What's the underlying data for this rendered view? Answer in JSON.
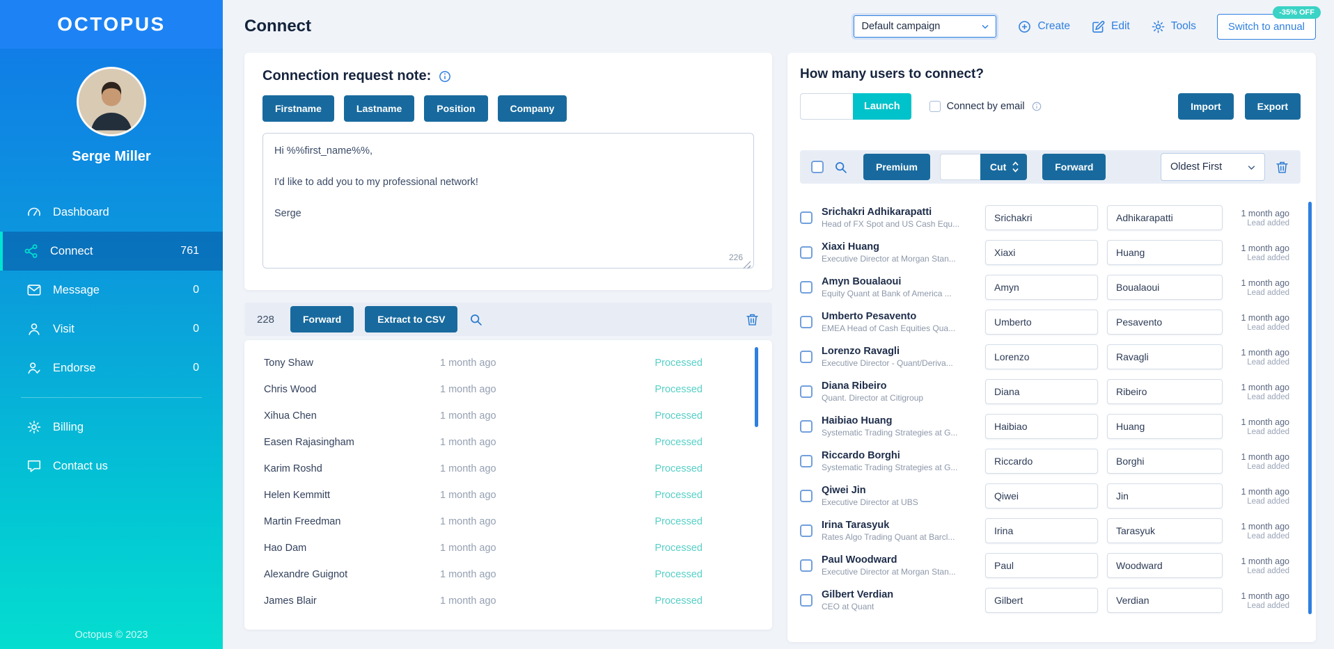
{
  "colors": {
    "accent_blue": "#2f80e0",
    "button_blue": "#186a9e",
    "teal": "#00c2ca",
    "status_teal": "#57cfc7",
    "sidebar_top": "#1177e8",
    "sidebar_bottom": "#05ddd0"
  },
  "sidebar": {
    "logo": "OCTOPUS",
    "user": {
      "name": "Serge Miller"
    },
    "nav": [
      {
        "label": "Dashboard",
        "count": ""
      },
      {
        "label": "Connect",
        "count": "761"
      },
      {
        "label": "Message",
        "count": "0"
      },
      {
        "label": "Visit",
        "count": "0"
      },
      {
        "label": "Endorse",
        "count": "0"
      }
    ],
    "secondary": [
      {
        "label": "Billing"
      },
      {
        "label": "Contact us"
      }
    ],
    "footer": "Octopus © 2023"
  },
  "header": {
    "title": "Connect",
    "campaign_select": "Default campaign",
    "create": "Create",
    "edit": "Edit",
    "tools": "Tools",
    "switch_annual": "Switch to annual",
    "discount_badge": "-35% OFF"
  },
  "note_panel": {
    "title": "Connection request note:",
    "insert_buttons": [
      "Firstname",
      "Lastname",
      "Position",
      "Company"
    ],
    "message": "Hi %%first_name%%,\n\nI'd like to add you to my professional network!\n\nSerge",
    "char_count": "226",
    "toolbar": {
      "count": "228",
      "forward": "Forward",
      "extract_csv": "Extract to CSV"
    },
    "rows": [
      {
        "name": "Tony Shaw",
        "time": "1 month ago",
        "status": "Processed"
      },
      {
        "name": "Chris Wood",
        "time": "1 month ago",
        "status": "Processed"
      },
      {
        "name": "Xihua Chen",
        "time": "1 month ago",
        "status": "Processed"
      },
      {
        "name": "Easen Rajasingham",
        "time": "1 month ago",
        "status": "Processed"
      },
      {
        "name": "Karim Roshd",
        "time": "1 month ago",
        "status": "Processed"
      },
      {
        "name": "Helen Kemmitt",
        "time": "1 month ago",
        "status": "Processed"
      },
      {
        "name": "Martin Freedman",
        "time": "1 month ago",
        "status": "Processed"
      },
      {
        "name": "Hao Dam",
        "time": "1 month ago",
        "status": "Processed"
      },
      {
        "name": "Alexandre Guignot",
        "time": "1 month ago",
        "status": "Processed"
      },
      {
        "name": "James Blair",
        "time": "1 month ago",
        "status": "Processed"
      }
    ]
  },
  "connect_panel": {
    "title": "How many users to connect?",
    "users_input": "",
    "launch": "Launch",
    "connect_by_email": "Connect by email",
    "import": "Import",
    "export": "Export",
    "toolbar": {
      "premium": "Premium",
      "cut_value": "",
      "cut": "Cut",
      "forward": "Forward",
      "sort": "Oldest First"
    },
    "users": [
      {
        "name": "Srichakri Adhikarapatti",
        "subtitle": "Head of FX Spot and US Cash Equ...",
        "first": "Srichakri",
        "last": "Adhikarapatti",
        "time": "1 month ago",
        "status": "Lead added"
      },
      {
        "name": "Xiaxi Huang",
        "subtitle": "Executive Director at Morgan Stan...",
        "first": "Xiaxi",
        "last": "Huang",
        "time": "1 month ago",
        "status": "Lead added"
      },
      {
        "name": "Amyn Boualaoui",
        "subtitle": "Equity Quant at Bank of America ...",
        "first": "Amyn",
        "last": "Boualaoui",
        "time": "1 month ago",
        "status": "Lead added"
      },
      {
        "name": "Umberto Pesavento",
        "subtitle": "EMEA Head of Cash Equities Qua...",
        "first": "Umberto",
        "last": "Pesavento",
        "time": "1 month ago",
        "status": "Lead added"
      },
      {
        "name": "Lorenzo Ravagli",
        "subtitle": "Executive Director - Quant/Deriva...",
        "first": "Lorenzo",
        "last": "Ravagli",
        "time": "1 month ago",
        "status": "Lead added"
      },
      {
        "name": "Diana Ribeiro",
        "subtitle": "Quant. Director at Citigroup",
        "first": "Diana",
        "last": "Ribeiro",
        "time": "1 month ago",
        "status": "Lead added"
      },
      {
        "name": "Haibiao Huang",
        "subtitle": "Systematic Trading Strategies at G...",
        "first": "Haibiao",
        "last": "Huang",
        "time": "1 month ago",
        "status": "Lead added"
      },
      {
        "name": "Riccardo Borghi",
        "subtitle": "Systematic Trading Strategies at G...",
        "first": "Riccardo",
        "last": "Borghi",
        "time": "1 month ago",
        "status": "Lead added"
      },
      {
        "name": "Qiwei Jin",
        "subtitle": "Executive Director at UBS",
        "first": "Qiwei",
        "last": "Jin",
        "time": "1 month ago",
        "status": "Lead added"
      },
      {
        "name": "Irina Tarasyuk",
        "subtitle": "Rates Algo Trading Quant at Barcl...",
        "first": "Irina",
        "last": "Tarasyuk",
        "time": "1 month ago",
        "status": "Lead added"
      },
      {
        "name": "Paul Woodward",
        "subtitle": "Executive Director at Morgan Stan...",
        "first": "Paul",
        "last": "Woodward",
        "time": "1 month ago",
        "status": "Lead added"
      },
      {
        "name": "Gilbert Verdian",
        "subtitle": "CEO at Quant",
        "first": "Gilbert",
        "last": "Verdian",
        "time": "1 month ago",
        "status": "Lead added"
      }
    ]
  }
}
